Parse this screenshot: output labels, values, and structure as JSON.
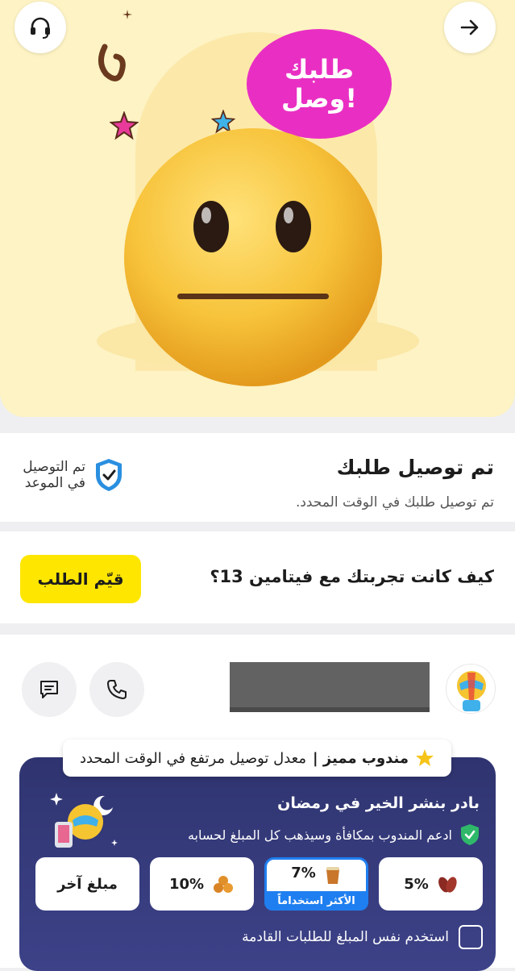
{
  "hero": {
    "bubble_text": "طلبك وصل!",
    "icons": [
      "headset-icon",
      "arrow-right-icon",
      "neutral-face-emoji"
    ]
  },
  "status": {
    "title": "تم توصيل طلبك",
    "subtitle": "تم توصيل طلبك في الوقت المحدد.",
    "ontime_label": "تم التوصيل في الموعد"
  },
  "rating": {
    "question": "كيف كانت تجربتك مع فيتامين 13؟",
    "button_label": "قيّم الطلب"
  },
  "driver": {
    "badge_bold": "مندوب مميز |",
    "badge_text": "معدل توصيل مرتفع في الوقت المحدد",
    "icons": [
      "call-icon",
      "chat-icon",
      "star-icon"
    ]
  },
  "promo": {
    "title": "بادر بنشر الخير في رمضان",
    "subtitle": "ادعم المندوب بمكافأة وسيذهب كل المبلغ لحسابه",
    "tips": [
      {
        "label": "5%",
        "icon": "dates-icon"
      },
      {
        "label": "7%",
        "icon": "tea-icon",
        "ribbon": "الأكثر استخداماً",
        "selected": true
      },
      {
        "label": "10%",
        "icon": "sweets-icon"
      },
      {
        "label": "مبلغ آخر"
      }
    ],
    "reuse_label": "استخدم نفس المبلغ للطلبات القادمة"
  },
  "colors": {
    "hero_bg": "#fdf3c4",
    "bubble": "#e92fc3",
    "accent_yellow": "#ffe600",
    "promo_bg": "#2f3470",
    "selected_blue": "#1f7ff0"
  }
}
